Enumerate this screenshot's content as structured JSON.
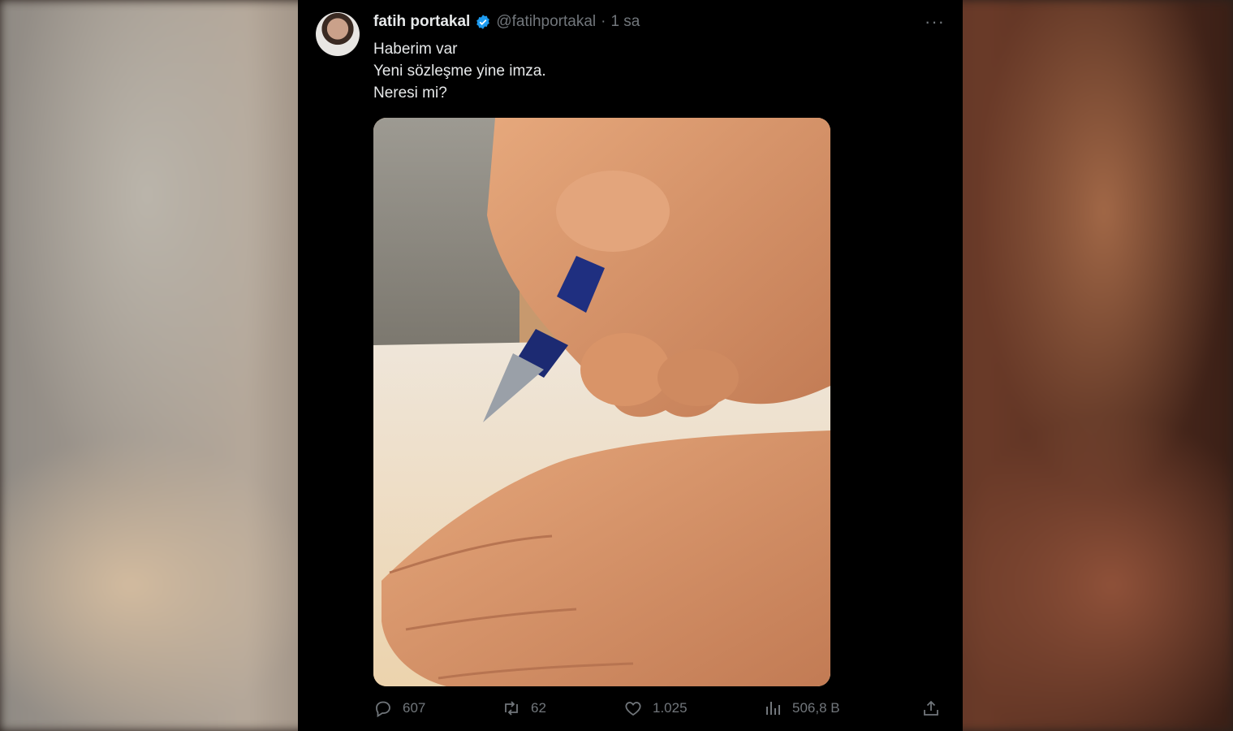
{
  "tweet": {
    "author_name": "fatih portakal",
    "author_handle": "@fatihportakal",
    "separator": "·",
    "time": "1 sa",
    "lines": [
      "Haberim var",
      "Yeni sözleşme yine imza.",
      "Neresi mi?"
    ]
  },
  "actions": {
    "replies": "607",
    "retweets": "62",
    "likes": "1.025",
    "views": "506,8 B"
  },
  "icons": {
    "verified": "verified-badge-icon",
    "more": "more-options-icon",
    "reply": "reply-icon",
    "retweet": "retweet-icon",
    "like": "heart-icon",
    "views": "views-chart-icon",
    "share": "share-icon"
  },
  "colors": {
    "background": "#000000",
    "text": "#e7e9ea",
    "secondary": "#71767b",
    "verified": "#1d9bf0"
  }
}
